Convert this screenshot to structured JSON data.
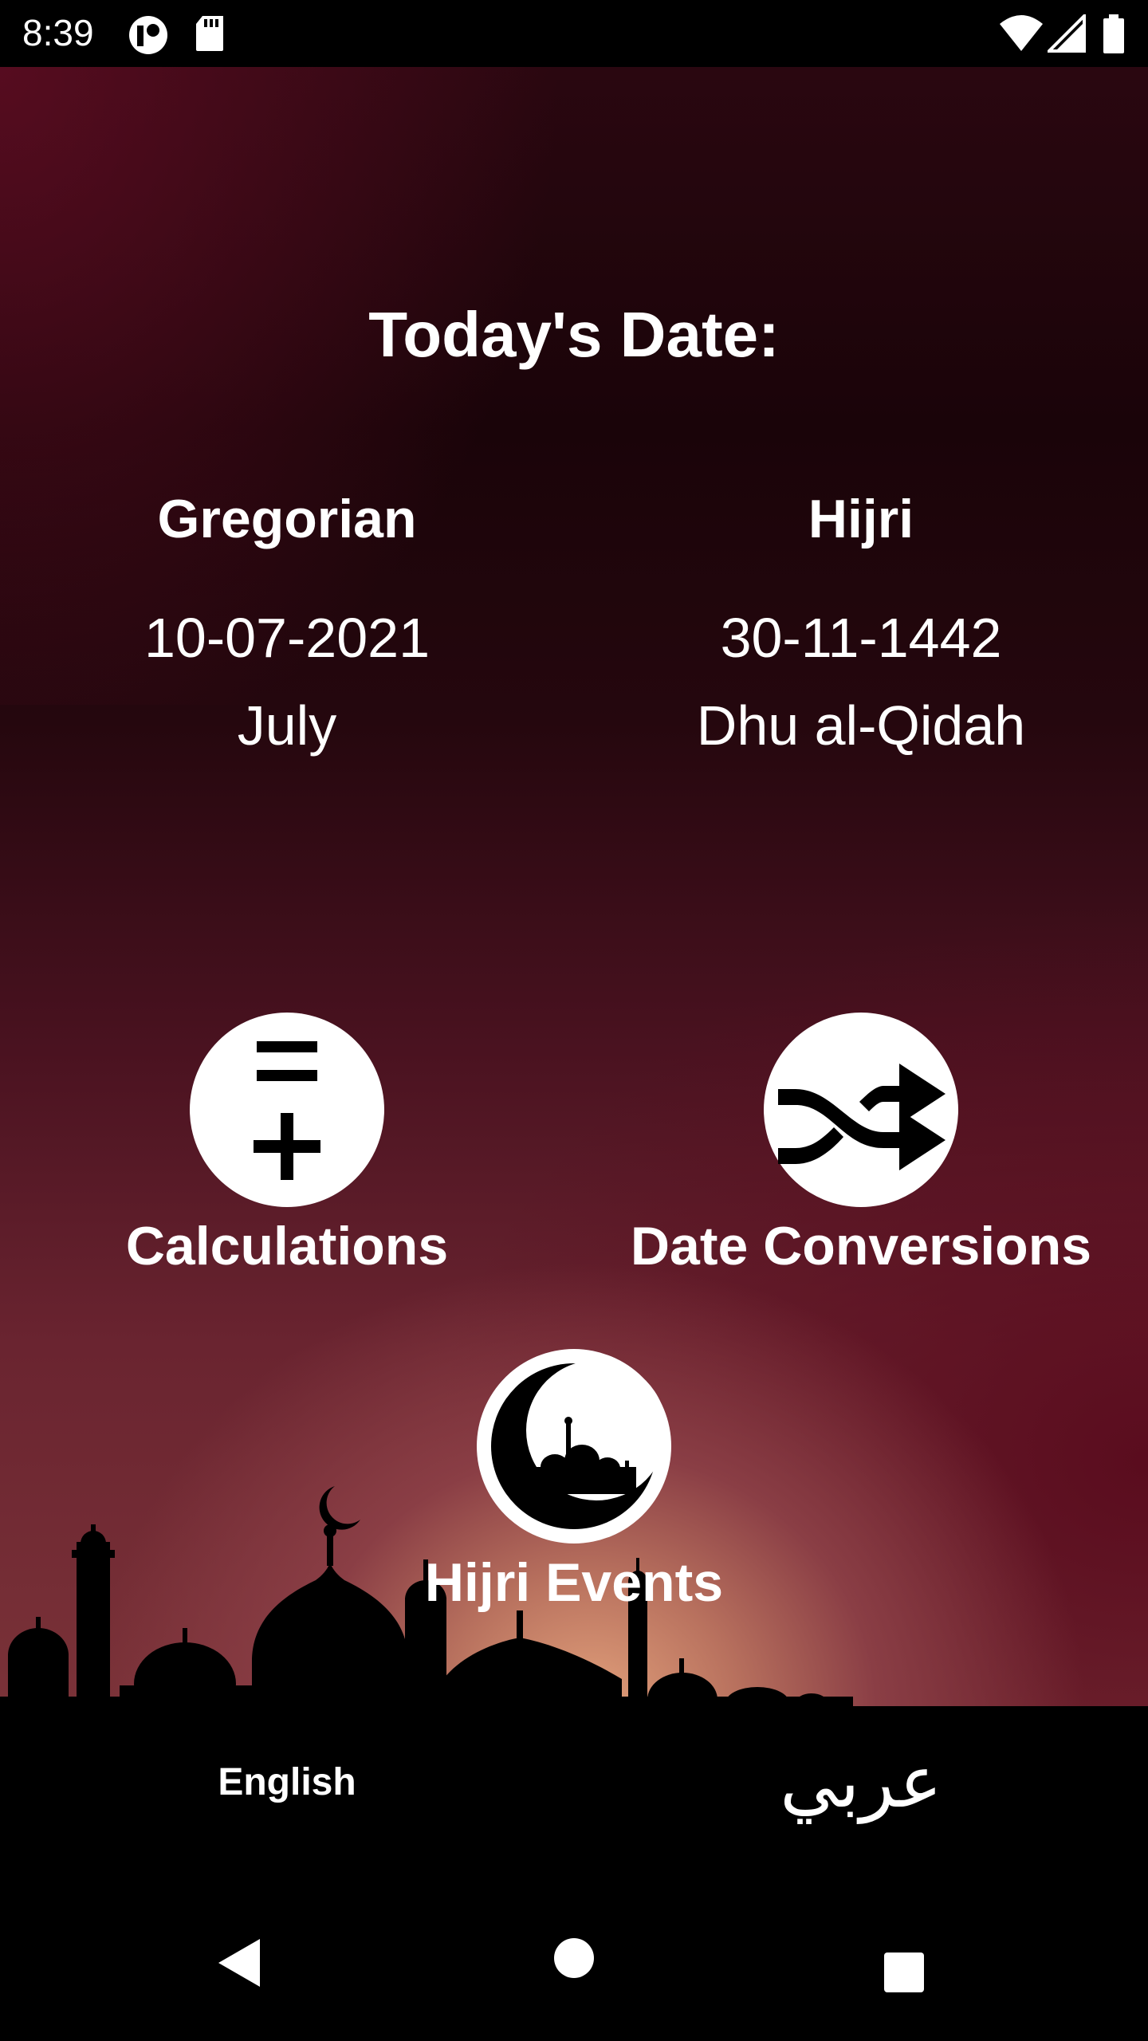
{
  "status_bar": {
    "time": "8:39",
    "icons": [
      "app-notification-icon",
      "sd-card-icon",
      "wifi-icon",
      "signal-icon",
      "battery-icon"
    ]
  },
  "main": {
    "title": "Today's Date:",
    "gregorian": {
      "heading": "Gregorian",
      "date": "10-07-2021",
      "month": "July"
    },
    "hijri": {
      "heading": "Hijri",
      "date": "30-11-1442",
      "month": "Dhu al-Qidah"
    }
  },
  "actions": {
    "calculations": {
      "label": "Calculations",
      "icon": "equals-plus-icon"
    },
    "conversions": {
      "label": "Date Conversions",
      "icon": "shuffle-icon"
    },
    "events": {
      "label": "Hijri Events",
      "icon": "crescent-mosque-icon"
    }
  },
  "language": {
    "english": "English",
    "arabic": "عربي"
  },
  "nav": [
    "back-icon",
    "home-icon",
    "recents-icon"
  ],
  "colors": {
    "background_top": "#1a0409",
    "glow": "#e3a27c",
    "accent_crimson": "#5a0c1e"
  }
}
